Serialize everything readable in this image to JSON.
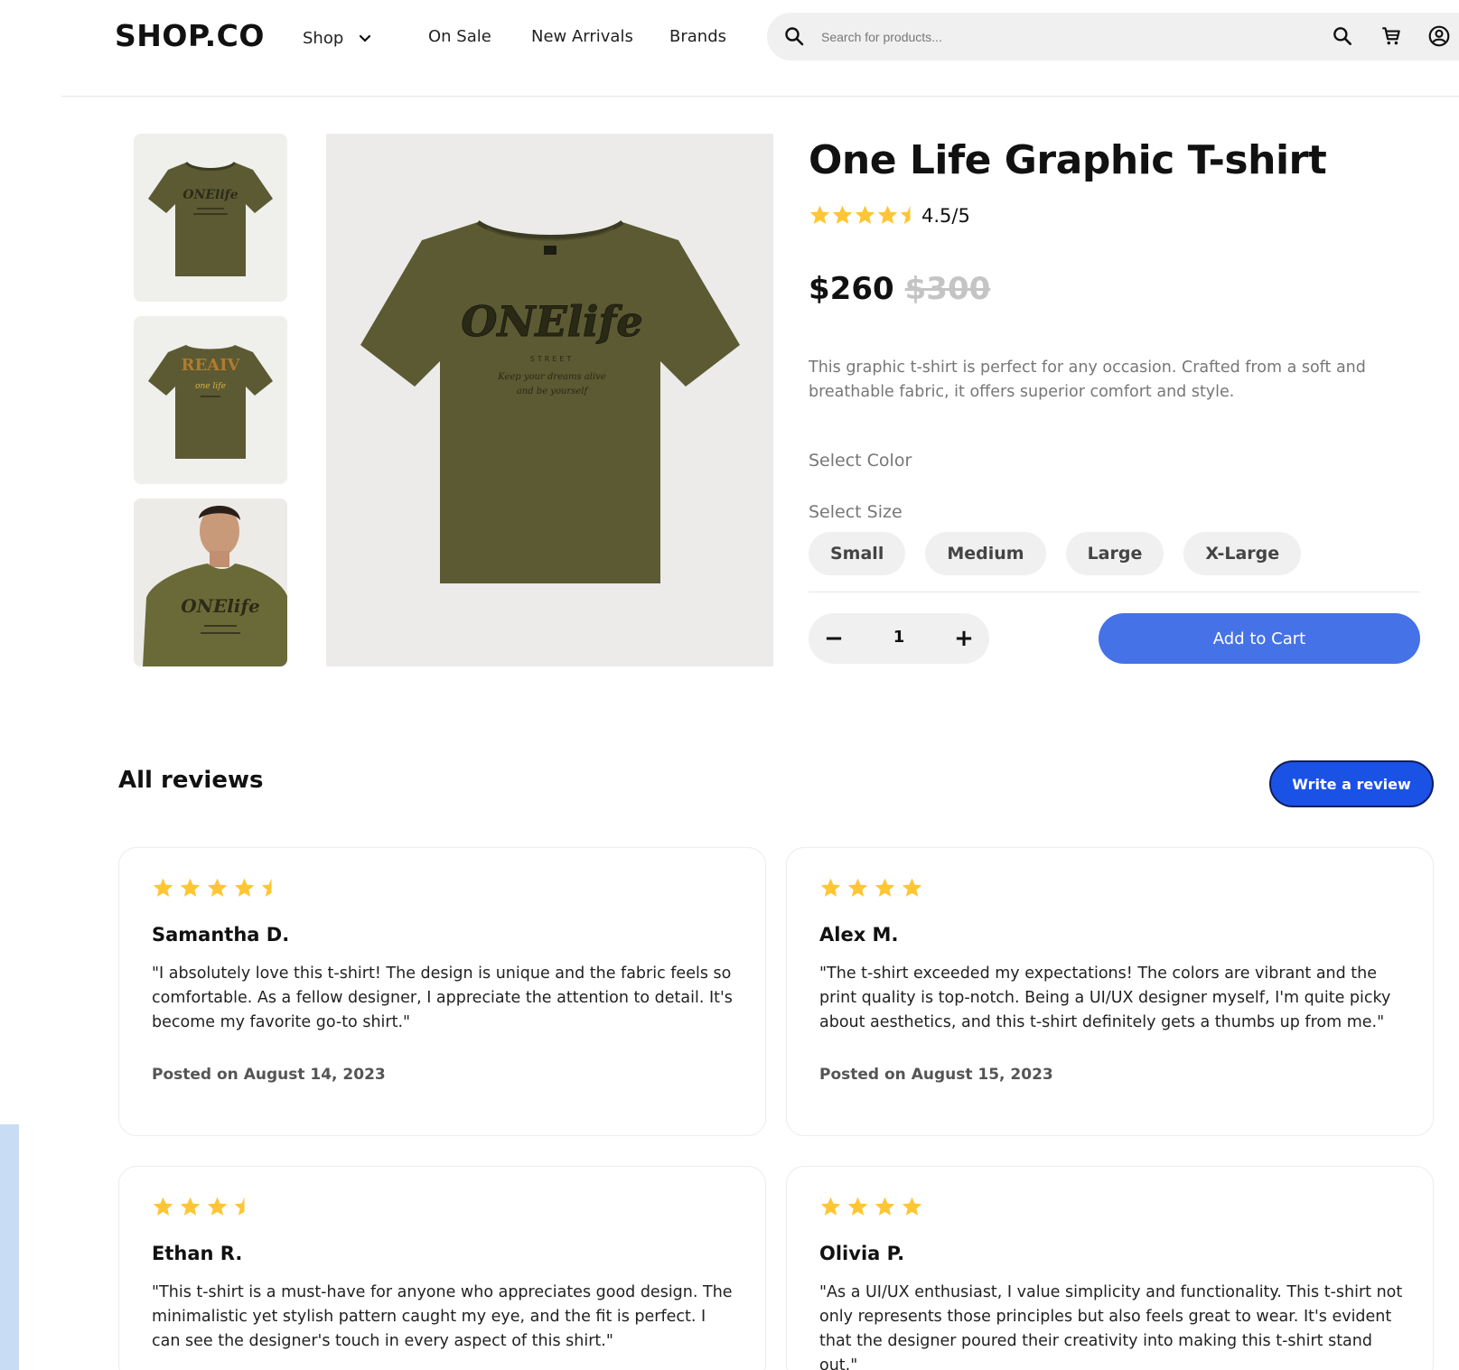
{
  "header": {
    "logo": "SHOP.CO",
    "nav": {
      "shop": "Shop",
      "on_sale": "On Sale",
      "new_arrivals": "New Arrivals",
      "brands": "Brands"
    },
    "search_placeholder": "Search for products..."
  },
  "product": {
    "title": "One Life Graphic T-shirt",
    "rating_value": 4.5,
    "rating_text": "4.5/5",
    "price": "$260",
    "old_price": "$300",
    "description": "This graphic t-shirt is perfect for any occasion. Crafted from a soft and breathable fabric, it offers superior comfort and style.",
    "select_color_label": "Select Color",
    "select_size_label": "Select Size",
    "sizes": [
      "Small",
      "Medium",
      "Large",
      "X-Large"
    ],
    "quantity": "1",
    "qty_minus": "−",
    "qty_plus": "+",
    "add_to_cart": "Add to Cart",
    "shirt_color": "#5b5a33"
  },
  "reviews": {
    "title": "All reviews",
    "write_button": "Write a review",
    "items": [
      {
        "rating": 4.5,
        "name": "Samantha D.",
        "text": "\"I absolutely love this t-shirt! The design is unique and the fabric feels so comfortable. As a fellow designer, I appreciate the attention to detail. It's become my favorite go-to shirt.\"",
        "date": "Posted on August 14, 2023"
      },
      {
        "rating": 4,
        "name": "Alex M.",
        "text": "\"The t-shirt exceeded my expectations! The colors are vibrant and the print quality is top-notch. Being a UI/UX designer myself, I'm quite picky about aesthetics, and this t-shirt definitely gets a thumbs up from me.\"",
        "date": "Posted on August 15, 2023"
      },
      {
        "rating": 3.5,
        "name": "Ethan R.",
        "text": "\"This t-shirt is a must-have for anyone who appreciates good design. The minimalistic yet stylish pattern caught my eye, and the fit is perfect. I can see the designer's touch in every aspect of this shirt.\"",
        "date": ""
      },
      {
        "rating": 4,
        "name": "Olivia P.",
        "text": "\"As a UI/UX enthusiast, I value simplicity and functionality. This t-shirt not only represents those principles but also feels great to wear. It's evident that the designer poured their creativity into making this t-shirt stand out.\"",
        "date": ""
      }
    ]
  },
  "colors": {
    "star": "#ffc633",
    "primary_button": "#4672e8",
    "review_button": "#1a52e6",
    "muted_text": "#777777"
  }
}
